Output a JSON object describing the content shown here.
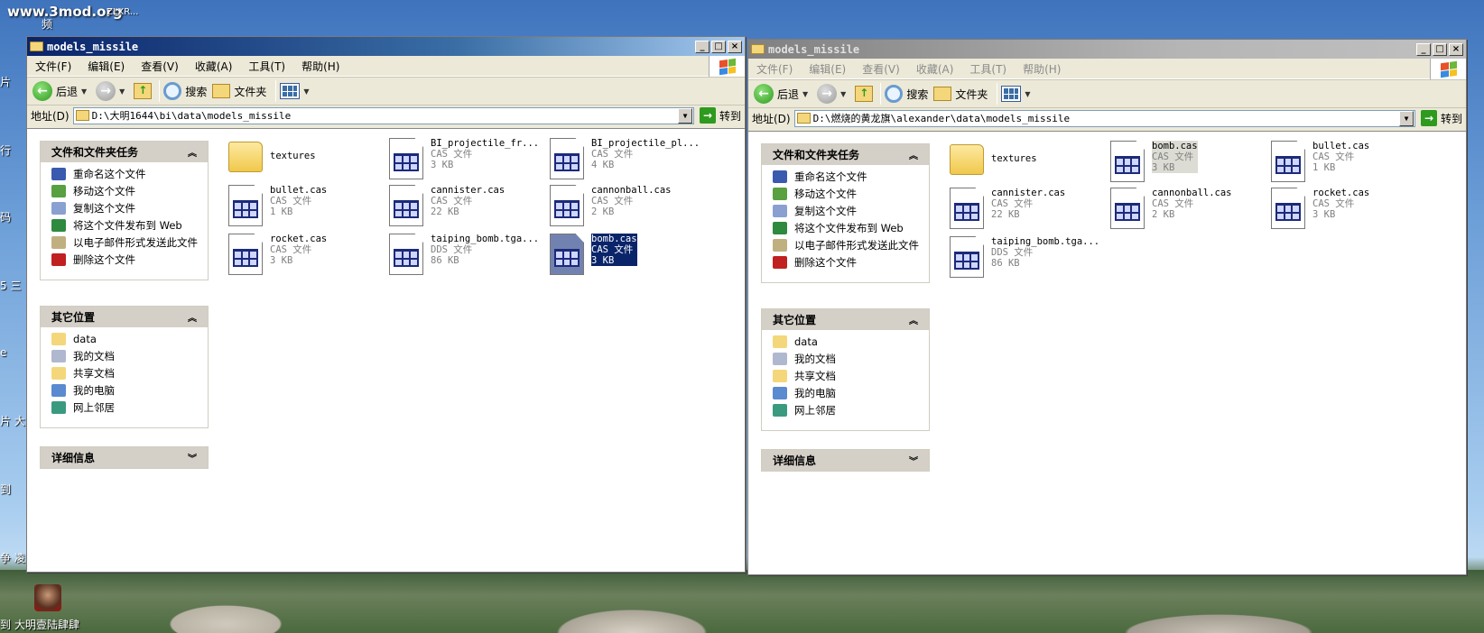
{
  "desktop": {
    "watermark": "www.3mod.org",
    "top_label": "ZLXR...",
    "top_label2": "频",
    "edge_labels": [
      "片",
      "行",
      "码",
      "5 三",
      "e",
      "片 大",
      "到",
      "争 凌",
      "到"
    ],
    "shortcut_label": "大明壹陆肆肆"
  },
  "windows": [
    {
      "state": "active",
      "title": "models_missile",
      "menu": [
        "文件(F)",
        "编辑(E)",
        "查看(V)",
        "收藏(A)",
        "工具(T)",
        "帮助(H)"
      ],
      "toolbar": {
        "back": "后退",
        "search": "搜索",
        "folders": "文件夹"
      },
      "address": {
        "label": "地址(D)",
        "value": "D:\\大明1644\\bi\\data\\models_missile",
        "go": "转到"
      },
      "tasks": {
        "title": "文件和文件夹任务",
        "items": [
          "重命名这个文件",
          "移动这个文件",
          "复制这个文件",
          "将这个文件发布到 Web",
          "以电子邮件形式发送此文件",
          "删除这个文件"
        ]
      },
      "places": {
        "title": "其它位置",
        "items": [
          "data",
          "我的文档",
          "共享文档",
          "我的电脑",
          "网上邻居"
        ]
      },
      "details": {
        "title": "详细信息"
      },
      "files": [
        {
          "name": "textures",
          "kind": "folder"
        },
        {
          "name": "BI_projectile_fr...",
          "type": "CAS 文件",
          "size": "3 KB"
        },
        {
          "name": "BI_projectile_pl...",
          "type": "CAS 文件",
          "size": "4 KB"
        },
        {
          "name": "bullet.cas",
          "type": "CAS 文件",
          "size": "1 KB"
        },
        {
          "name": "cannister.cas",
          "type": "CAS 文件",
          "size": "22 KB"
        },
        {
          "name": "cannonball.cas",
          "type": "CAS 文件",
          "size": "2 KB"
        },
        {
          "name": "rocket.cas",
          "type": "CAS 文件",
          "size": "3 KB"
        },
        {
          "name": "taiping_bomb.tga...",
          "type": "DDS 文件",
          "size": "86 KB"
        },
        {
          "name": "bomb.cas",
          "type": "CAS 文件",
          "size": "3 KB",
          "selected": true
        }
      ]
    },
    {
      "state": "inactive",
      "title": "models_missile",
      "menu": [
        "文件(F)",
        "编辑(E)",
        "查看(V)",
        "收藏(A)",
        "工具(T)",
        "帮助(H)"
      ],
      "toolbar": {
        "back": "后退",
        "search": "搜索",
        "folders": "文件夹"
      },
      "address": {
        "label": "地址(D)",
        "value": "D:\\燃烧的黄龙旗\\alexander\\data\\models_missile",
        "go": "转到"
      },
      "tasks": {
        "title": "文件和文件夹任务",
        "items": [
          "重命名这个文件",
          "移动这个文件",
          "复制这个文件",
          "将这个文件发布到 Web",
          "以电子邮件形式发送此文件",
          "删除这个文件"
        ]
      },
      "places": {
        "title": "其它位置",
        "items": [
          "data",
          "我的文档",
          "共享文档",
          "我的电脑",
          "网上邻居"
        ]
      },
      "details": {
        "title": "详细信息"
      },
      "files": [
        {
          "name": "textures",
          "kind": "folder"
        },
        {
          "name": "bomb.cas",
          "type": "CAS 文件",
          "size": "3 KB",
          "selected": true
        },
        {
          "name": "bullet.cas",
          "type": "CAS 文件",
          "size": "1 KB"
        },
        {
          "name": "cannister.cas",
          "type": "CAS 文件",
          "size": "22 KB"
        },
        {
          "name": "cannonball.cas",
          "type": "CAS 文件",
          "size": "2 KB"
        },
        {
          "name": "rocket.cas",
          "type": "CAS 文件",
          "size": "3 KB"
        },
        {
          "name": "taiping_bomb.tga...",
          "type": "DDS 文件",
          "size": "86 KB"
        }
      ]
    }
  ],
  "colors": {
    "active_title": "#0a246a",
    "selection": "#0a246a",
    "panel_header": "#d4d0c8"
  }
}
